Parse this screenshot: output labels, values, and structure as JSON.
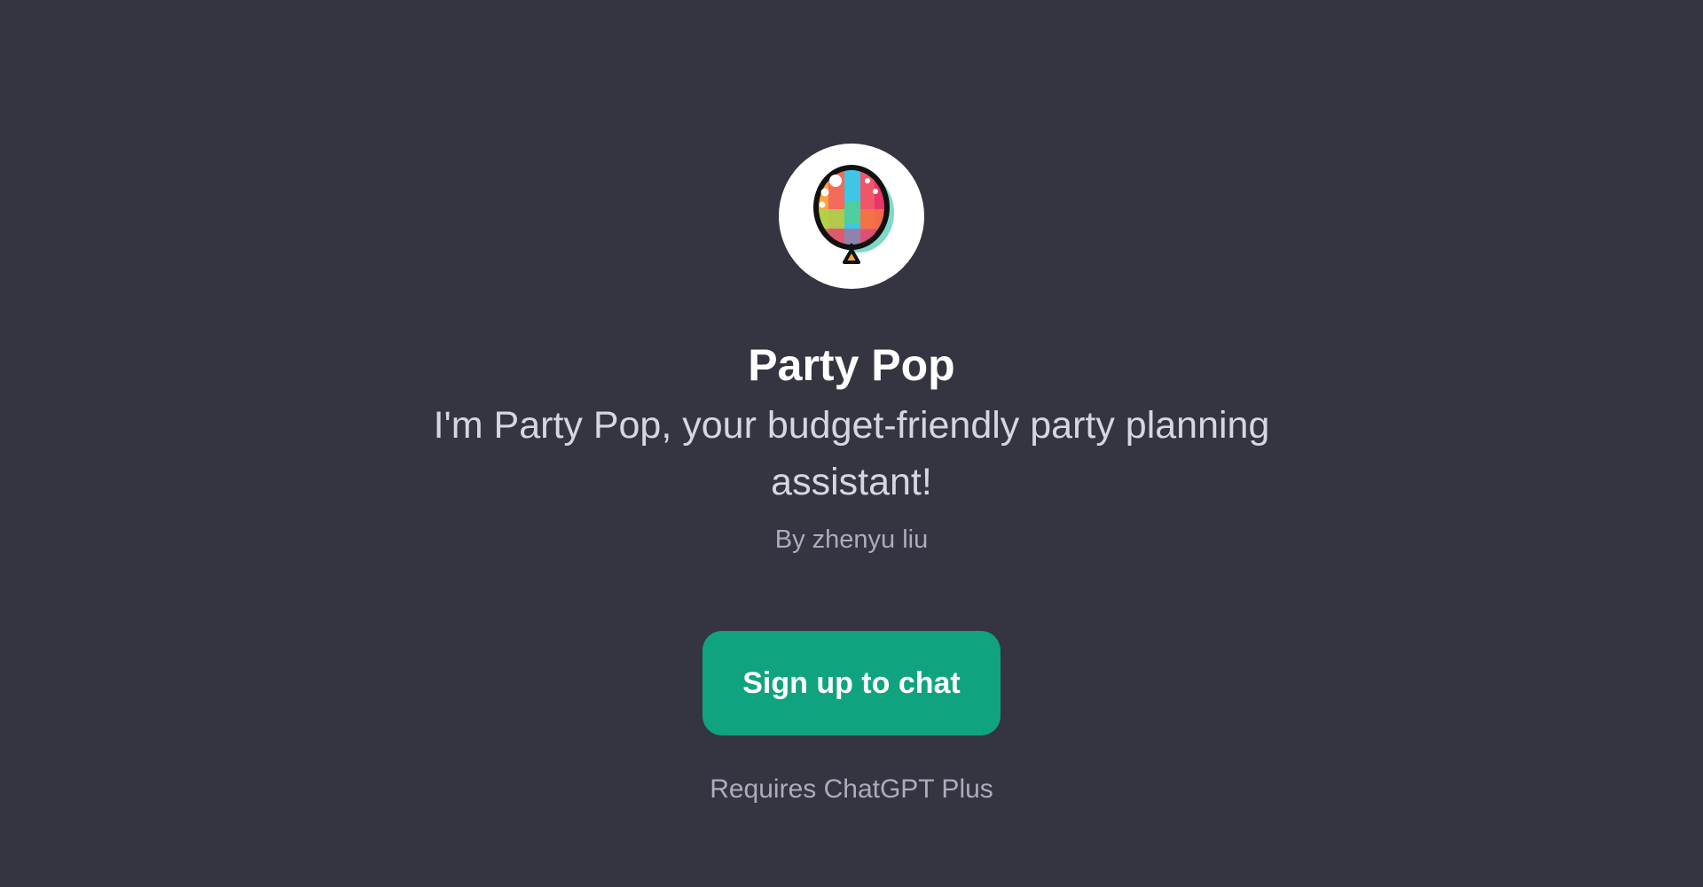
{
  "gpt": {
    "name": "Party Pop",
    "description": "I'm Party Pop, your budget-friendly party planning assistant!",
    "author": "By zhenyu liu",
    "avatar_icon": "balloon-icon"
  },
  "actions": {
    "signup_label": "Sign up to chat",
    "requirement": "Requires ChatGPT Plus"
  },
  "colors": {
    "background": "#343541",
    "accent": "#10a37f",
    "text_primary": "#ffffff",
    "text_secondary": "#acacbe"
  }
}
